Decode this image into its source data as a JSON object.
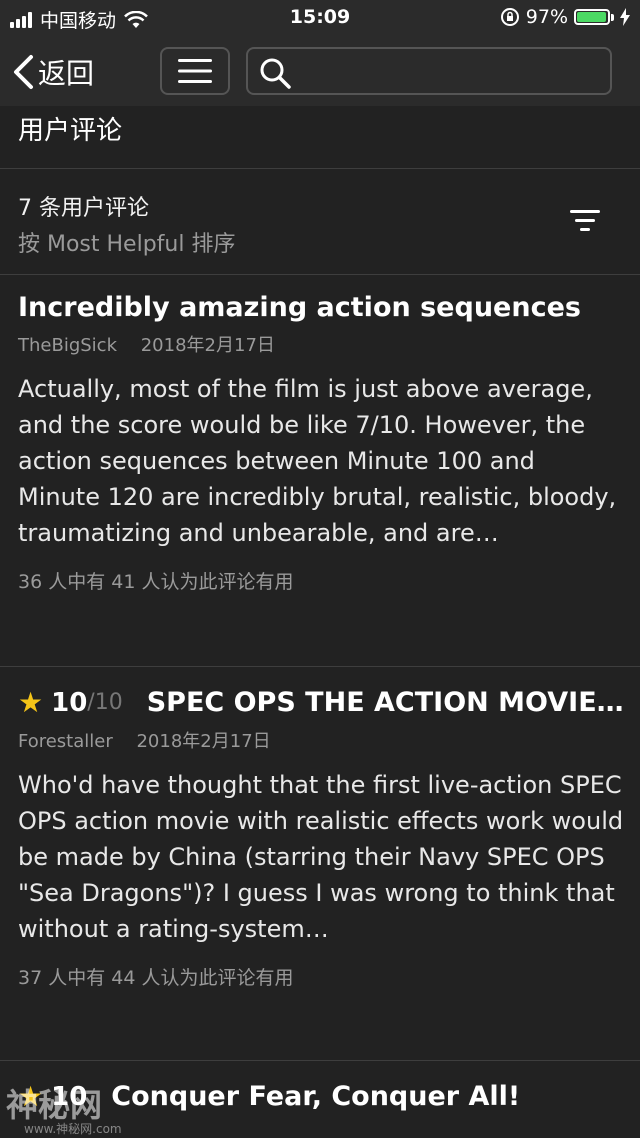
{
  "status": {
    "carrier": "中国移动",
    "time": "15:09",
    "battery": "97%",
    "battery_level": 0.97
  },
  "nav": {
    "back_label": "返回"
  },
  "section_title": "用户评论",
  "summary": {
    "count": "7 条用户评论",
    "sort": "按 Most Helpful 排序"
  },
  "reviews": [
    {
      "title": "Incredibly amazing action sequences",
      "author": "TheBigSick",
      "date": "2018年2月17日",
      "body": "Actually, most of the film is just above average, and the score would be like 7/10. However, the action sequences between Minute 100 and Minute 120 are incredibly brutal, realistic, bloody, traumatizing and unbearable, and are…",
      "helpful": "36 人中有 41 人认为此评论有用"
    },
    {
      "rating": "10",
      "rating_max": "/10",
      "title": "SPEC OPS THE ACTION MOVIE…",
      "author": "Forestaller",
      "date": "2018年2月17日",
      "body": "Who'd have thought that the first live-action SPEC OPS action movie with realistic effects work would be made by China (starring their Navy SPEC OPS \"Sea Dragons\")? I guess I was wrong to think that without a rating-system…",
      "helpful": "37 人中有 44 人认为此评论有用"
    },
    {
      "rating": "10",
      "title": "Conquer Fear, Conquer All!"
    }
  ],
  "watermark": {
    "text": "神秘网",
    "sub": "www.神秘网.com"
  },
  "colors": {
    "background": "#222222",
    "bar": "#2b2b2b",
    "star": "#f5c518",
    "battery": "#4cd964"
  }
}
